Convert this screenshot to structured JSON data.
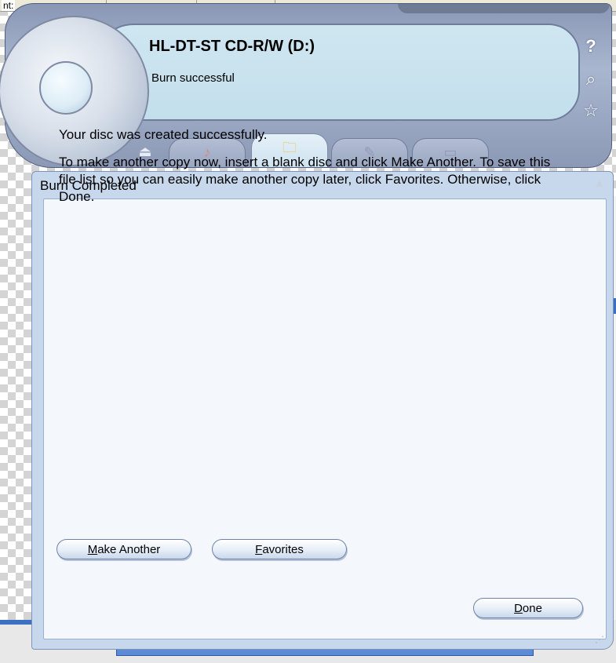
{
  "background": {
    "label": "nt:"
  },
  "player": {
    "drive_name": "HL-DT-ST CD-R/W (D:)",
    "status": "Burn successful",
    "side_icons": [
      "help-icon",
      "search-icon",
      "star-icon"
    ],
    "help_glyph": "?",
    "search_glyph": "⌕",
    "star_glyph": "☆",
    "tabs": [
      {
        "name": "eject",
        "glyph": "⏏"
      },
      {
        "name": "audio",
        "glyph": "♪"
      },
      {
        "name": "data",
        "glyph": "🗀"
      },
      {
        "name": "tools",
        "glyph": "✎"
      },
      {
        "name": "video",
        "glyph": "▭"
      }
    ]
  },
  "panel": {
    "title": "Burn Completed",
    "collapse_glyph": "▲",
    "message_1": "Your disc was created successfully.",
    "message_2": "To make another copy now, insert a blank disc and click Make Another. To save this file list so you can easily make another copy later, click Favorites. Otherwise, click Done.",
    "buttons": {
      "make_another": {
        "accel": "M",
        "rest": "ake Another"
      },
      "favorites": {
        "accel": "F",
        "rest": "avorites"
      },
      "done": {
        "accel": "D",
        "rest": "one"
      }
    },
    "grip_glyph": "⋰"
  },
  "colors": {
    "shell": "#a9b6cf",
    "screen": "#c3dfec",
    "panel": "#c8d8ec",
    "panel_body": "#f4f7fc"
  }
}
